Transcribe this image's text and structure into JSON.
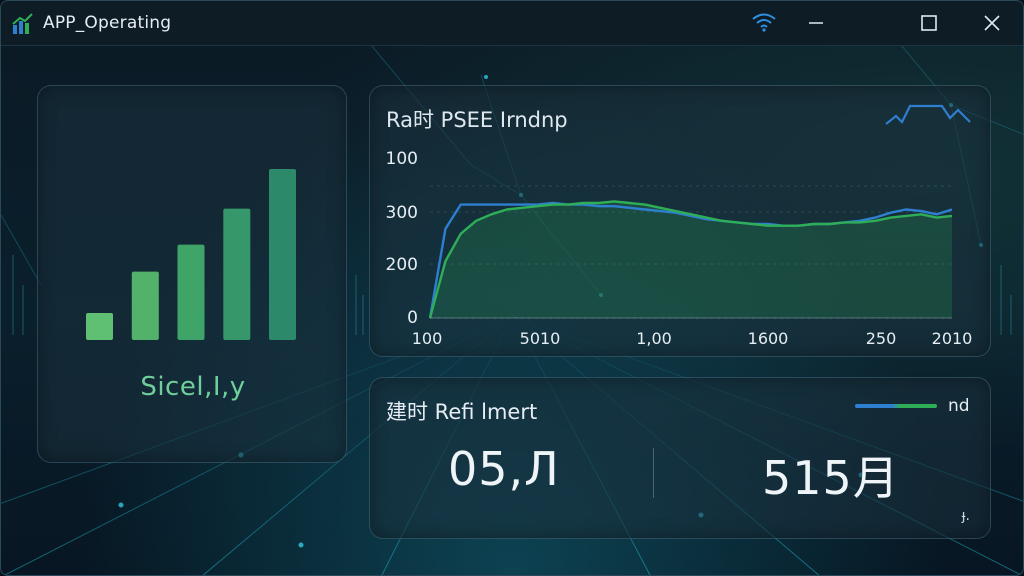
{
  "window": {
    "title": "APP_Operating",
    "controls": {
      "wifi": "wifi-icon",
      "minimize": "minimize-icon",
      "maximize": "maximize-icon",
      "close": "close-icon"
    }
  },
  "left_panel": {
    "label": "Sicel,I,y",
    "bar_values": [
      0.15,
      0.38,
      0.53,
      0.73,
      0.95
    ],
    "bar_colors": [
      "#5fbf72",
      "#52b26a",
      "#3fa468",
      "#36976a",
      "#2c8a6a"
    ]
  },
  "chart_panel": {
    "title": "Ra时 PSEE Irndnp",
    "spark_icon": "sparkline-icon",
    "accent_blue": "#2f7fd0",
    "accent_green": "#2fae58",
    "chart_data": {
      "type": "line",
      "y_tick_labels": [
        "100",
        "300",
        "200",
        "0"
      ],
      "x_tick_labels": [
        "100",
        "5010",
        "1,00",
        "1600",
        "250",
        "2010"
      ],
      "series": [
        {
          "values": [
            0,
            0.55,
            0.7,
            0.7,
            0.7,
            0.7,
            0.7,
            0.7,
            0.71,
            0.7,
            0.7,
            0.69,
            0.69,
            0.68,
            0.67,
            0.66,
            0.65,
            0.63,
            0.61,
            0.6,
            0.59,
            0.58,
            0.58,
            0.57,
            0.57,
            0.58,
            0.58,
            0.59,
            0.6,
            0.62,
            0.65,
            0.67,
            0.66,
            0.64,
            0.67
          ]
        },
        {
          "values": [
            0,
            0.35,
            0.52,
            0.6,
            0.64,
            0.67,
            0.68,
            0.69,
            0.7,
            0.7,
            0.71,
            0.71,
            0.72,
            0.71,
            0.7,
            0.68,
            0.66,
            0.64,
            0.62,
            0.6,
            0.59,
            0.58,
            0.57,
            0.57,
            0.57,
            0.58,
            0.58,
            0.59,
            0.59,
            0.6,
            0.62,
            0.63,
            0.64,
            0.62,
            0.63
          ]
        }
      ],
      "ylim": [
        0,
        1
      ]
    }
  },
  "summary_panel": {
    "title": "建时 Refi lmert",
    "legend_label": "nd",
    "value_left": "05,Л",
    "value_right": "515月",
    "corner_mark": "ɟ."
  }
}
